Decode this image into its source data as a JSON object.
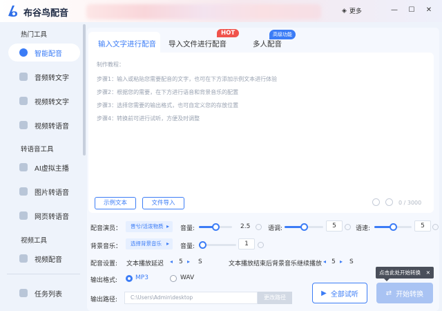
{
  "app": {
    "title": "布谷鸟配音",
    "more_label": "更多"
  },
  "sidebar": {
    "sections": [
      {
        "label": "热门工具"
      },
      {
        "label": "转语音工具"
      },
      {
        "label": "视频工具"
      }
    ],
    "items": [
      {
        "label": "智能配音",
        "icon": "mic-icon",
        "active": true
      },
      {
        "label": "音频转文字",
        "icon": "audio-text-icon"
      },
      {
        "label": "视频转文字",
        "icon": "video-text-icon"
      },
      {
        "label": "视频转语音",
        "icon": "video-audio-icon"
      },
      {
        "label": "AI虚拟主播",
        "icon": "ai-anchor-icon"
      },
      {
        "label": "图片转语音",
        "icon": "image-audio-icon"
      },
      {
        "label": "网页转语音",
        "icon": "web-audio-icon"
      },
      {
        "label": "视频配音",
        "icon": "video-dub-icon"
      },
      {
        "label": "任务列表",
        "icon": "task-list-icon"
      }
    ]
  },
  "tabs": [
    {
      "label": "输入文字进行配音",
      "active": true
    },
    {
      "label": "导入文件进行配音",
      "badge": "HOT"
    },
    {
      "label": "多人配音",
      "badge": "高级功能"
    }
  ],
  "guide": {
    "title": "制作教程：",
    "steps": [
      "步骤1：输入或粘贴您需要配音的文字，也可在下方添加示例文本进行体验",
      "步骤2：根据您的需要，在下方进行语音和背景音乐的配置",
      "步骤3：选择您需要的输出格式，也可自定义您的存放位置",
      "步骤4：转换前可进行试听，方便及时调整"
    ]
  },
  "editor": {
    "sample_button": "示例文本",
    "import_button": "文件导入",
    "char_count": "0 / 3000"
  },
  "settings": {
    "voice_label": "配音演员：",
    "voice_value": "晋兮/活泼物质",
    "volume_label": "音量:",
    "volume_value": "2.5",
    "volume_fraction": 0.5,
    "tone_label": "语调:",
    "tone_value": "5",
    "tone_fraction": 0.5,
    "speed_label": "语速:",
    "speed_value": "5",
    "speed_fraction": 0.5,
    "bgm_label": "背景音乐：",
    "bgm_value": "选择背景音乐",
    "bgm_volume_label": "音量:",
    "bgm_volume_value": "1",
    "bgm_volume_fraction": 0.1,
    "config_label": "配音设置:",
    "delay_label": "文本播放延迟",
    "delay_value": "5",
    "delay_unit": "S",
    "after_label": "文本播放结束后背景音乐继续播放",
    "after_value": "5",
    "after_unit": "S"
  },
  "output": {
    "format_label": "输出格式:",
    "formats": [
      {
        "label": "MP3",
        "selected": true
      },
      {
        "label": "WAV",
        "selected": false
      }
    ],
    "path_label": "输出路径:",
    "path_value": "C:\\Users\\Admin\\desktop",
    "change_path_button": "更改路径"
  },
  "actions": {
    "preview_button": "全部试听",
    "convert_button": "开始转换",
    "tooltip": "点击此处开始转换"
  },
  "colors": {
    "accent": "#3b7cf6",
    "hot": "#f0534b",
    "convert_disabled": "#a9c3f3"
  }
}
